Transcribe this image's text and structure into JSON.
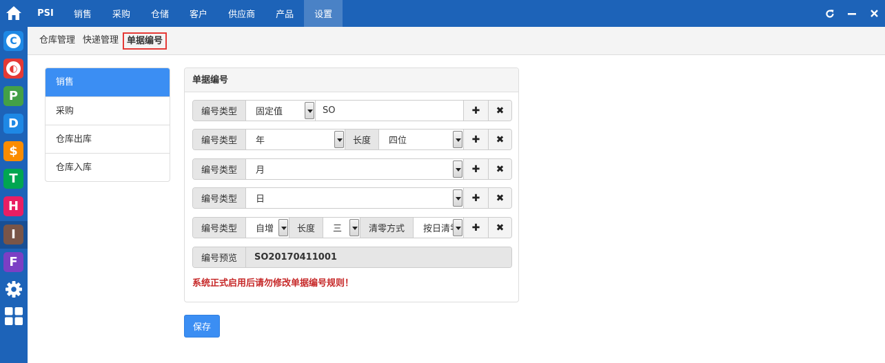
{
  "rail": {
    "items": [
      {
        "letter": "C",
        "color": "#1e88e5"
      },
      {
        "letter": "◐",
        "color": "#e53935"
      },
      {
        "letter": "P",
        "color": "#43a047"
      },
      {
        "letter": "D",
        "color": "#1e88e5"
      },
      {
        "letter": "$",
        "color": "#fb8c00"
      },
      {
        "letter": "T",
        "color": "#00a651"
      },
      {
        "letter": "H",
        "color": "#e91e63"
      },
      {
        "letter": "I",
        "color": "#795548"
      },
      {
        "letter": "F",
        "color": "#7b3fc4"
      }
    ]
  },
  "topnav": {
    "brand": "PSI",
    "items": [
      "销售",
      "采购",
      "仓储",
      "客户",
      "供应商",
      "产品",
      "设置"
    ],
    "active_index": 6
  },
  "subnav": {
    "items": [
      "仓库管理",
      "快递管理",
      "单据编号"
    ],
    "active_index": 2
  },
  "doclist": {
    "items": [
      "销售",
      "采购",
      "仓库出库",
      "仓库入库"
    ],
    "active_index": 0
  },
  "panel": {
    "title": "单据编号",
    "rows": [
      {
        "type_label": "编号类型",
        "type_value": "固定值",
        "text_value": "SO"
      },
      {
        "type_label": "编号类型",
        "type_value": "年",
        "length_label": "长度",
        "length_value": "四位"
      },
      {
        "type_label": "编号类型",
        "type_value": "月"
      },
      {
        "type_label": "编号类型",
        "type_value": "日"
      },
      {
        "type_label": "编号类型",
        "type_value": "自增",
        "length_label": "长度",
        "length_value": "三",
        "reset_label": "清零方式",
        "reset_value": "按日清零"
      }
    ],
    "add_glyph": "✚",
    "remove_glyph": "✖",
    "preview_label": "编号预览",
    "preview_value": "SO20170411001",
    "warning": "系统正式启用后请勿修改单据编号规则！"
  },
  "save_label": "保存",
  "colors": {
    "brand_blue": "#1d63b8",
    "active_blue": "#3b8ef3",
    "warning_red": "#c62828"
  }
}
